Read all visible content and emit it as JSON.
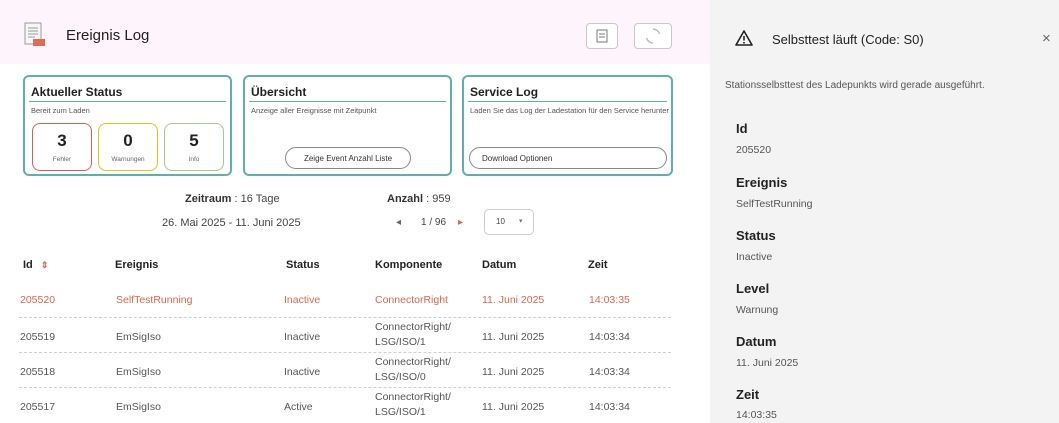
{
  "header": {
    "title": "Ereignis Log"
  },
  "cards": {
    "status": {
      "title": "Aktueller Status",
      "subtitle": "Bereit zum Laden",
      "stats": [
        {
          "value": "3",
          "label": "Fehler",
          "color": "#e05a5a"
        },
        {
          "value": "0",
          "label": "Warnungen",
          "color": "#e6c020"
        },
        {
          "value": "5",
          "label": "Info",
          "color": "#a8c88a"
        }
      ]
    },
    "overview": {
      "title": "Übersicht",
      "subtitle": "Anzeige aller Ereignisse mit Zeitpunkt",
      "button": "Zeige Event Anzahl Liste"
    },
    "service": {
      "title": "Service Log",
      "subtitle": "Laden Sie das Log der Ladestation für den Service herunter",
      "button": "Download Optionen"
    }
  },
  "summary": {
    "zeitraum_label": "Zeitraum",
    "zeitraum_value": ": 16 Tage",
    "anzahl_label": "Anzahl",
    "anzahl_value": ": 959",
    "date_range": "26. Mai 2025 - 11. Juni 2025"
  },
  "pagination": {
    "page": "1 / 96",
    "prev": "◂",
    "next": "▸",
    "page_size": "10"
  },
  "table": {
    "columns": [
      "Id",
      "Ereignis",
      "Status",
      "Komponente",
      "Datum",
      "Zeit"
    ],
    "rows": [
      {
        "id": "205520",
        "ereignis": "SelfTestRunning",
        "status": "Inactive",
        "komp1": "ConnectorRight",
        "komp2": "",
        "datum": "11. Juni 2025",
        "zeit": "14:03:35"
      },
      {
        "id": "205519",
        "ereignis": "EmSigIso",
        "status": "Inactive",
        "komp1": "ConnectorRight/",
        "komp2": "LSG/ISO/1",
        "datum": "11. Juni 2025",
        "zeit": "14:03:34"
      },
      {
        "id": "205518",
        "ereignis": "EmSigIso",
        "status": "Inactive",
        "komp1": "ConnectorRight/",
        "komp2": "LSG/ISO/0",
        "datum": "11. Juni 2025",
        "zeit": "14:03:34"
      },
      {
        "id": "205517",
        "ereignis": "EmSigIso",
        "status": "Active",
        "komp1": "ConnectorRight/",
        "komp2": "LSG/ISO/1",
        "datum": "11. Juni 2025",
        "zeit": "14:03:34"
      }
    ]
  },
  "detail": {
    "title": "Selbsttest läuft (Code: S0)",
    "description": "Stationsselbsttest des Ladepunkts wird gerade ausgeführt.",
    "fields": [
      {
        "label": "Id",
        "value": "205520"
      },
      {
        "label": "Ereignis",
        "value": "SelfTestRunning"
      },
      {
        "label": "Status",
        "value": "Inactive"
      },
      {
        "label": "Level",
        "value": "Warnung"
      },
      {
        "label": "Datum",
        "value": "11. Juni 2025"
      },
      {
        "label": "Zeit",
        "value": "14:03:35"
      }
    ]
  },
  "colors": {
    "accent": "#5bb3a8",
    "selected_row": "#e0654a",
    "header_bg": "#fdf5fb",
    "side_bg": "#f3f3f3"
  }
}
